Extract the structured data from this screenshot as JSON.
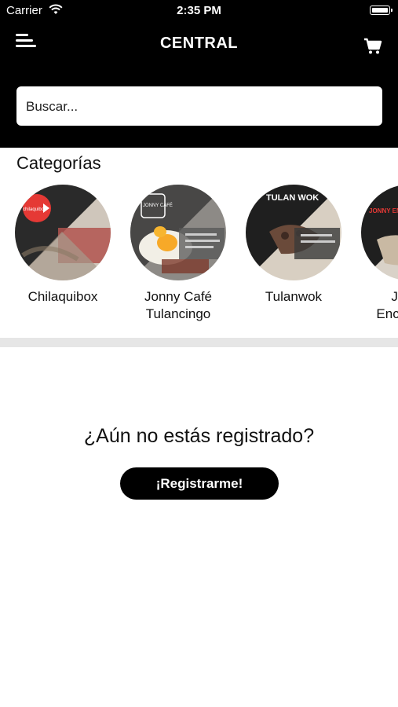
{
  "status_bar": {
    "carrier": "Carrier",
    "time": "2:35 PM"
  },
  "header": {
    "title": "CENTRAL"
  },
  "search": {
    "placeholder": "Buscar..."
  },
  "categories": {
    "title": "Categorías",
    "items": [
      {
        "label": "Chilaquibox",
        "logo_text": "chilaquibox"
      },
      {
        "label": "Jonny Café\nTulancingo",
        "logo_text": "JONNY CAFÉ"
      },
      {
        "label": "Tulanwok",
        "logo_text": "TULAN WOK"
      },
      {
        "label": "Jonny\nEnchiladas",
        "logo_text": "JONNY ENCHILADAS"
      }
    ]
  },
  "register_prompt": {
    "question": "¿Aún no estás registrado?",
    "button": "¡Registrarme!"
  },
  "colors": {
    "header_bg": "#000000",
    "button_bg": "#000000",
    "divider": "#e6e6e6",
    "chilaquibox_red": "#e53935"
  }
}
